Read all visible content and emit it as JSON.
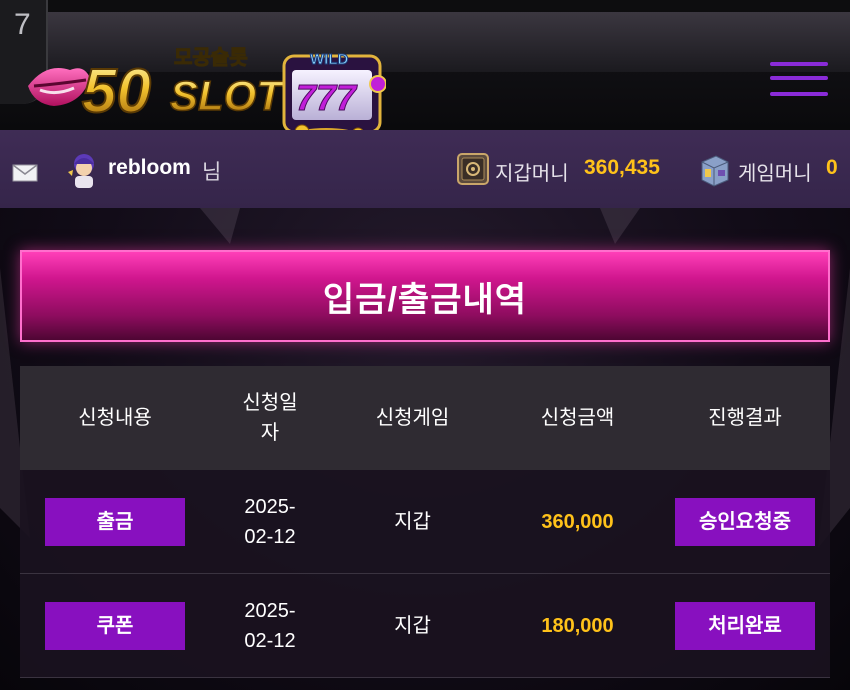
{
  "header": {
    "corner_badge": "7",
    "logo": {
      "brand_number": "50",
      "brand_word": "SLOT",
      "korean_text": "모공슬롯",
      "wild_text": "WILD",
      "reels_text": "777"
    },
    "menu_icon": "hamburger-icon"
  },
  "userbar": {
    "mail_icon": "mail-icon",
    "username": "rebloom",
    "username_suffix": "님",
    "wallet_label": "지갑머니",
    "wallet_value": "360,435",
    "game_label": "게임머니",
    "game_value": "0"
  },
  "page": {
    "title": "입금/출금내역"
  },
  "table": {
    "headers": [
      "신청내용",
      "신청일\n자",
      "신청게임",
      "신청금액",
      "진행결과"
    ],
    "rows": [
      {
        "type": "출금",
        "date": "2025-\n02-12",
        "game": "지갑",
        "amount": "360,000",
        "status": "승인요청중"
      },
      {
        "type": "쿠폰",
        "date": "2025-\n02-12",
        "game": "지갑",
        "amount": "180,000",
        "status": "처리완료"
      }
    ]
  },
  "colors": {
    "accent_purple": "#8810bf",
    "banner_pink": "#d0168e",
    "money_gold": "#ffc21a",
    "userbar_bg": "#3f2c55"
  }
}
